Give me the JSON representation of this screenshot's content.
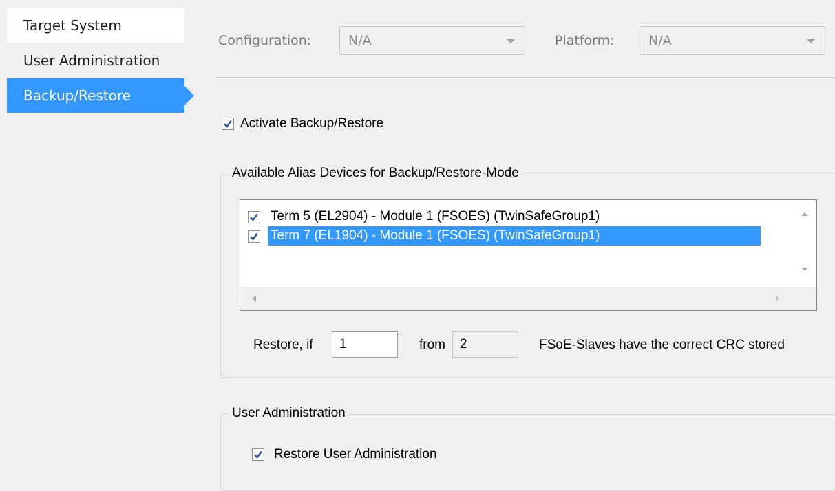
{
  "sidebar": {
    "items": [
      {
        "label": "Target System"
      },
      {
        "label": "User Administration"
      },
      {
        "label": "Backup/Restore"
      }
    ]
  },
  "header": {
    "configuration_label": "Configuration:",
    "configuration_value": "N/A",
    "platform_label": "Platform:",
    "platform_value": "N/A"
  },
  "backup": {
    "activate_label": "Activate Backup/Restore",
    "activate_checked": true
  },
  "alias_group": {
    "title": "Available Alias Devices for Backup/Restore-Mode",
    "devices": [
      {
        "label": "Term 5 (EL2904) - Module 1 (FSOES) (TwinSafeGroup1)",
        "checked": true,
        "selected": false
      },
      {
        "label": "Term 7 (EL1904) - Module 1 (FSOES) (TwinSafeGroup1)",
        "checked": true,
        "selected": true
      }
    ],
    "restore_if_label": "Restore, if",
    "restore_if_value": "1",
    "from_label": "from",
    "from_value": "2",
    "suffix_label": "FSoE-Slaves have the correct CRC stored"
  },
  "user_admin_group": {
    "title": "User Administration",
    "restore_label": "Restore User Administration",
    "restore_checked": true
  },
  "colors": {
    "accent": "#3399ff",
    "background": "#f0f0f0"
  }
}
